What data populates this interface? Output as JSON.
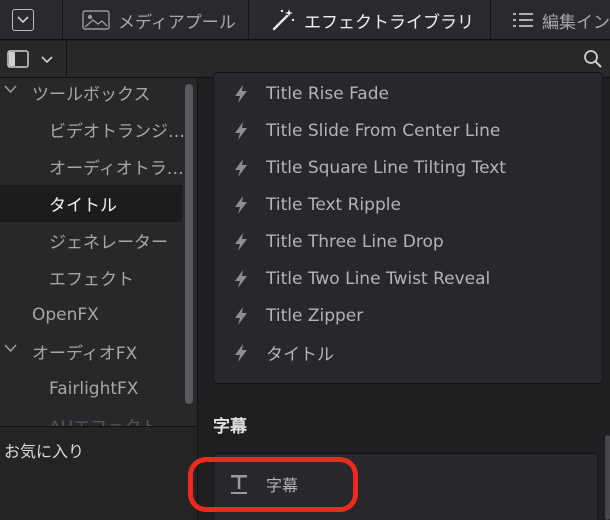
{
  "toolbar": {
    "media_pool_label": "メディアプール",
    "effects_library_label": "エフェクトライブラリ",
    "edit_index_label": "編集イン"
  },
  "sidebar": {
    "items": [
      {
        "label": "ツールボックス",
        "expanded": true
      },
      {
        "label": "ビデオトランジ…"
      },
      {
        "label": "オーディオトラ…"
      },
      {
        "label": "タイトル",
        "selected": true
      },
      {
        "label": "ジェネレーター"
      },
      {
        "label": "エフェクト"
      },
      {
        "label": "OpenFX"
      },
      {
        "label": "オーディオFX",
        "expanded": true
      },
      {
        "label": "FairlightFX"
      },
      {
        "label": "AUエフェクト"
      }
    ],
    "favorites_label": "お気に入り"
  },
  "titles_list": {
    "items": [
      "Title Rise Fade",
      "Title Slide From Center Line",
      "Title Square Line Tilting Text",
      "Title Text Ripple",
      "Title Three Line Drop",
      "Title Two Line Twist Reveal",
      "Title Zipper",
      "タイトル"
    ]
  },
  "subtitles": {
    "section_label": "字幕",
    "items": [
      "字幕"
    ]
  },
  "colors": {
    "highlight": "#ee2a1c",
    "accent_text": "#f2f2f2"
  }
}
